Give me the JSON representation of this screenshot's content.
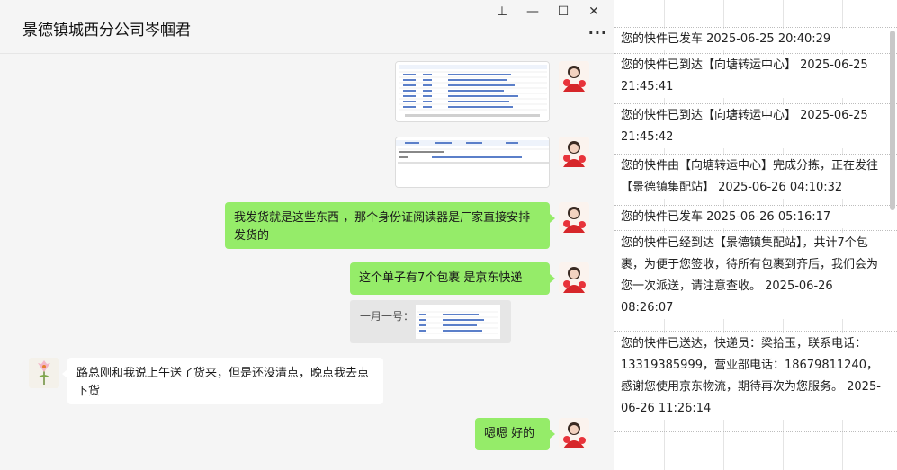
{
  "chat": {
    "title": "景德镇城西分公司岑帼君",
    "window": {
      "pin": "⊥",
      "minimize": "—",
      "maximize": "☐",
      "close": "✕"
    },
    "more": "···",
    "messages": [
      {
        "type": "image",
        "from": "me",
        "content": "spreadsheet screenshot of order list"
      },
      {
        "type": "image",
        "from": "me",
        "content": "spreadsheet screenshot of order header"
      },
      {
        "type": "text",
        "from": "me",
        "text": "我发货就是这些东西 ，那个身份证阅读器是厂家直接安排发货的"
      },
      {
        "type": "text",
        "from": "me",
        "text": "这个单子有7个包裹  是京东快递"
      },
      {
        "type": "quote",
        "from": "me",
        "label": "一月一号："
      },
      {
        "type": "text",
        "from": "other",
        "text": "路总刚和我说上午送了货来，但是还没清点，晚点我去点下货"
      },
      {
        "type": "text",
        "from": "me",
        "text": "嗯嗯 好的"
      }
    ]
  },
  "tracking": {
    "events": [
      "您的快件已发车 2025-06-25 20:40:29",
      "您的快件已到达【向塘转运中心】 2025-06-25 21:45:41",
      "您的快件已到达【向塘转运中心】 2025-06-25 21:45:42",
      "您的快件由【向塘转运中心】完成分拣，正在发往【景德镇集配站】 2025-06-26 04:10:32",
      "您的快件已发车 2025-06-26 05:16:17",
      "您的快件已经到达【景德镇集配站】，共计7个包裹，为便于您签收，待所有包裹到齐后，我们会为您一次派送，请注意查收。 2025-06-26 08:26:07",
      "您的快件已送达，快递员：梁拾玉，联系电话：13319385999，营业部电话：18679811240，感谢您使用京东物流，期待再次为您服务。 2025-06-26 11:26:14"
    ]
  },
  "colors": {
    "my_bubble": "#95ec69",
    "other_bubble": "#ffffff",
    "chat_bg": "#f5f5f5"
  }
}
